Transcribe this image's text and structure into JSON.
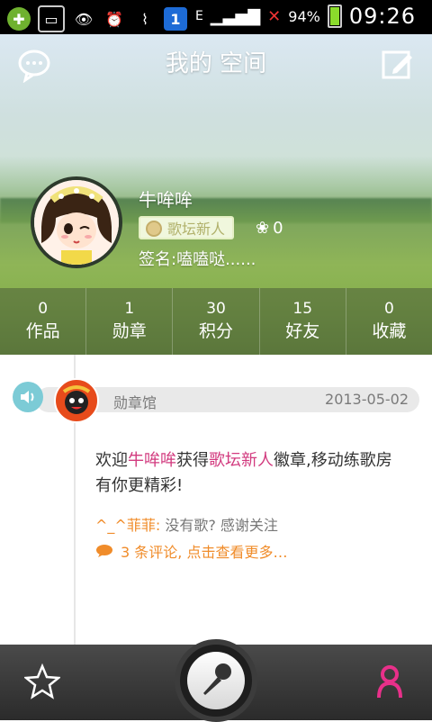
{
  "status_bar": {
    "battery_text": "94%",
    "signal_type": "E",
    "time": "09:26"
  },
  "header": {
    "title": "我的 空间"
  },
  "profile": {
    "name": "牛哞哞",
    "badge": "歌坛新人",
    "flowers": "0",
    "signature": "签名:嗑嗑哒......"
  },
  "stats": [
    {
      "value": "0",
      "label": "作品"
    },
    {
      "value": "1",
      "label": "勋章"
    },
    {
      "value": "30",
      "label": "积分"
    },
    {
      "value": "15",
      "label": "好友"
    },
    {
      "value": "0",
      "label": "收藏"
    }
  ],
  "feed": {
    "event": {
      "name": "勋章馆",
      "date": "2013-05-02"
    },
    "post": {
      "prefix": "欢迎",
      "user": "牛哞哞",
      "middle": "获得",
      "badge": "歌坛新人",
      "suffix": "徽章,移动练歌房有你更精彩!"
    },
    "comment": {
      "author": "^_^菲菲:",
      "text": "没有歌? 感谢关注"
    },
    "comments_link": "3 条评论, 点击查看更多…"
  },
  "colors": {
    "accent_pink": "#d23b7f",
    "accent_orange": "#f08c2a"
  }
}
